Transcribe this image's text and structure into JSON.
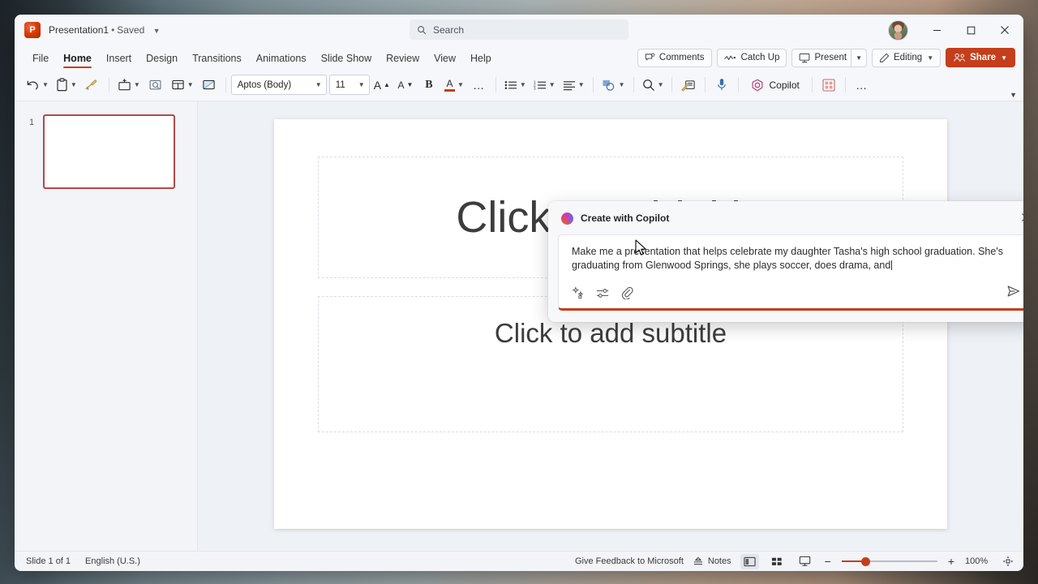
{
  "titlebar": {
    "app_icon": "powerpoint-logo-icon",
    "doc_name": "Presentation1",
    "separator": "•",
    "save_state": "Saved",
    "chevron": "chevron-down-icon",
    "search_placeholder": "Search",
    "minimize": "–",
    "maximize": "□",
    "close": "✕"
  },
  "ribbon_tabs": [
    {
      "label": "File",
      "active": false
    },
    {
      "label": "Home",
      "active": true
    },
    {
      "label": "Insert",
      "active": false
    },
    {
      "label": "Design",
      "active": false
    },
    {
      "label": "Transitions",
      "active": false
    },
    {
      "label": "Animations",
      "active": false
    },
    {
      "label": "Slide Show",
      "active": false
    },
    {
      "label": "Review",
      "active": false
    },
    {
      "label": "View",
      "active": false
    },
    {
      "label": "Help",
      "active": false
    }
  ],
  "tab_actions": {
    "comments": "Comments",
    "catch_up": "Catch Up",
    "present": "Present",
    "editing": "Editing",
    "share": "Share"
  },
  "toolbar": {
    "undo": "undo-icon",
    "paste": "paste-icon",
    "format_painter": "format-painter-icon",
    "new_slide": "new-slide-icon",
    "reset": "reset-slide-icon",
    "layout": "slide-layout-icon",
    "section": "section-icon",
    "font_name": "Aptos (Body)",
    "font_size": "11",
    "grow_font": "A",
    "shrink_font": "A",
    "bold": "B",
    "font_color": "A",
    "font_color_hex": "#c43e1c",
    "more_font": "…",
    "bullets": "bullets-icon",
    "numbering": "numbering-icon",
    "align": "align-icon",
    "shapes": "shapes-icon",
    "find": "find-icon",
    "designer": "designer-icon",
    "dictate": "microphone-icon",
    "copilot": "Copilot",
    "addins": "add-ins-icon",
    "more": "…"
  },
  "thumbnails": [
    {
      "number": "1"
    }
  ],
  "slide": {
    "title_placeholder": "Click to add title",
    "subtitle_placeholder": "Click to add subtitle"
  },
  "copilot_dialog": {
    "title": "Create with Copilot",
    "close": "✕",
    "prompt_text": "Make me a presentation that helps celebrate my daughter Tasha's high school graduation. She's graduating from Glenwood Springs, she plays soccer, does drama, and",
    "action_icons": [
      "prompt-ideas-icon",
      "settings-sliders-icon",
      "attach-file-icon"
    ],
    "send": "send-icon",
    "accent_hex": "#c43e1c"
  },
  "statusbar": {
    "slide_count": "Slide 1 of 1",
    "language": "English (U.S.)",
    "feedback": "Give Feedback to Microsoft",
    "notes": "Notes",
    "view_normal": "normal-view-icon",
    "view_sorter": "slide-sorter-icon",
    "view_reading": "reading-view-icon",
    "zoom_out": "−",
    "zoom_in": "+",
    "zoom_level": "100%",
    "fit_window": "fit-to-window-icon"
  }
}
